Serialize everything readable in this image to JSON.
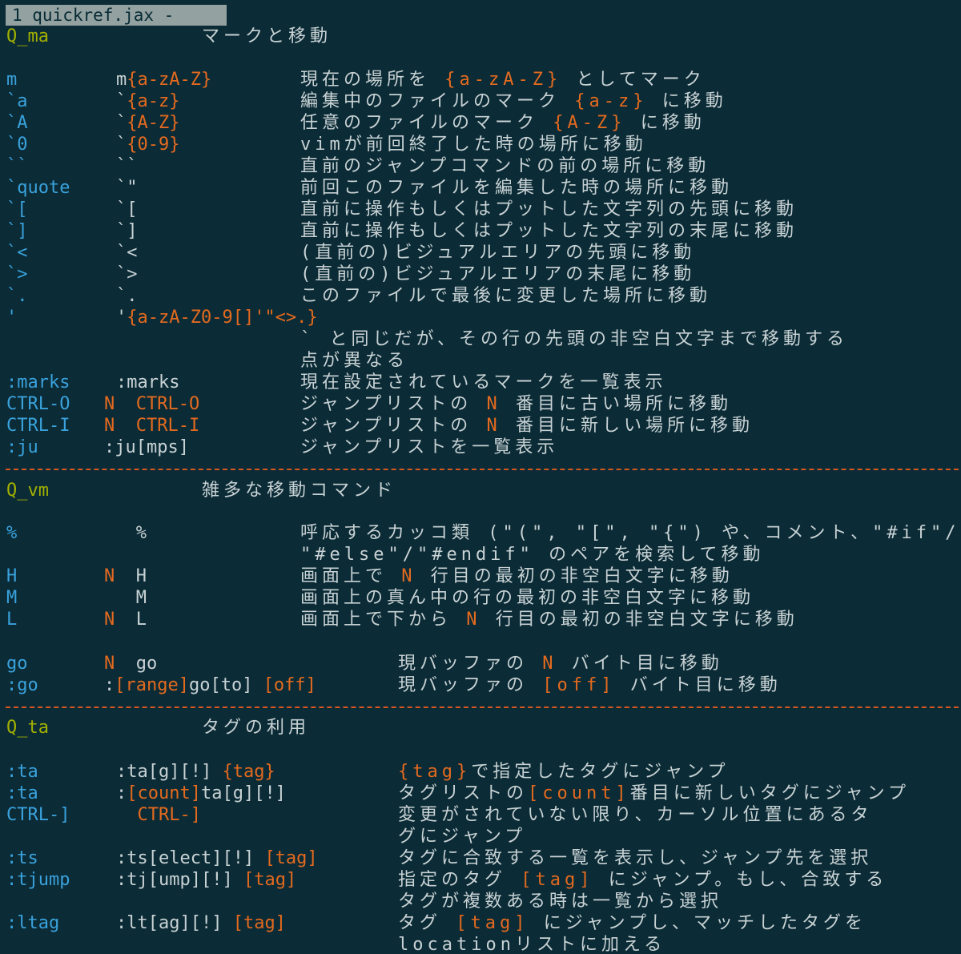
{
  "tab": {
    "label": "1 quickref.jax -"
  },
  "sections": [
    {
      "tag": "Q_ma",
      "title": "マークと移動",
      "entries": [
        {
          "key": "m",
          "cmd": [
            {
              "t": "m"
            },
            {
              "t": "{a-zA-Z}",
              "h": true
            }
          ],
          "desc": [
            {
              "t": "現在の場所を "
            },
            {
              "t": "{a-zA-Z}",
              "h": true
            },
            {
              "t": " としてマーク"
            }
          ]
        },
        {
          "key": "`a",
          "cmd": [
            {
              "t": "`"
            },
            {
              "t": "{a-z}",
              "h": true
            }
          ],
          "desc": [
            {
              "t": "編集中のファイルのマーク "
            },
            {
              "t": "{a-z}",
              "h": true
            },
            {
              "t": " に移動"
            }
          ]
        },
        {
          "key": "`A",
          "cmd": [
            {
              "t": "`"
            },
            {
              "t": "{A-Z}",
              "h": true
            }
          ],
          "desc": [
            {
              "t": "任意のファイルのマーク "
            },
            {
              "t": "{A-Z}",
              "h": true
            },
            {
              "t": " に移動"
            }
          ]
        },
        {
          "key": "`0",
          "cmd": [
            {
              "t": "`"
            },
            {
              "t": "{0-9}",
              "h": true
            }
          ],
          "desc": [
            {
              "t": "vimが前回終了した時の場所に移動"
            }
          ]
        },
        {
          "key": "``",
          "cmd": [
            {
              "t": "``"
            }
          ],
          "desc": [
            {
              "t": "直前のジャンプコマンドの前の場所に移動"
            }
          ]
        },
        {
          "key": "`quote",
          "cmd": [
            {
              "t": "`\""
            }
          ],
          "desc": [
            {
              "t": "前回このファイルを編集した時の場所に移動"
            }
          ]
        },
        {
          "key": "`[",
          "cmd": [
            {
              "t": "`["
            }
          ],
          "desc": [
            {
              "t": "直前に操作もしくはプットした文字列の先頭に移動"
            }
          ]
        },
        {
          "key": "`]",
          "cmd": [
            {
              "t": "`]"
            }
          ],
          "desc": [
            {
              "t": "直前に操作もしくはプットした文字列の末尾に移動"
            }
          ]
        },
        {
          "key": "`<",
          "cmd": [
            {
              "t": "`<"
            }
          ],
          "desc": [
            {
              "t": "(直前の)ビジュアルエリアの先頭に移動"
            }
          ]
        },
        {
          "key": "`>",
          "cmd": [
            {
              "t": "`>"
            }
          ],
          "desc": [
            {
              "t": "(直前の)ビジュアルエリアの末尾に移動"
            }
          ]
        },
        {
          "key": "`.",
          "cmd": [
            {
              "t": "`."
            }
          ],
          "desc": [
            {
              "t": "このファイルで最後に変更した場所に移動"
            }
          ]
        },
        {
          "key": "'",
          "cmd": [
            {
              "t": "'"
            },
            {
              "t": "{a-zA-Z0-9[]'\"<>.}",
              "h": true
            }
          ],
          "desc": []
        },
        {
          "key": "",
          "cmd": [],
          "desc": [
            {
              "t": "` と同じだが、その行の先頭の非空白文字まで移動する"
            }
          ]
        },
        {
          "key": "",
          "cmd": [],
          "desc": [
            {
              "t": "点が異なる"
            }
          ]
        },
        {
          "key": ":marks",
          "cmd": [
            {
              "t": ":marks"
            }
          ],
          "desc": [
            {
              "t": "現在設定されているマークを一覧表示"
            }
          ]
        },
        {
          "key": "CTRL-O",
          "cmd": [
            {
              "t": "N",
              "h": true
            },
            {
              "t": "  CTRL-O",
              "h": true
            }
          ],
          "desc": [
            {
              "t": "ジャンプリストの "
            },
            {
              "t": "N",
              "h": true
            },
            {
              "t": " 番目に古い場所に移動"
            }
          ]
        },
        {
          "key": "CTRL-I",
          "cmd": [
            {
              "t": "N",
              "h": true
            },
            {
              "t": "  CTRL-I",
              "h": true
            }
          ],
          "desc": [
            {
              "t": "ジャンプリストの "
            },
            {
              "t": "N",
              "h": true
            },
            {
              "t": " 番目に新しい場所に移動"
            }
          ]
        },
        {
          "key": ":ju",
          "cmd": [
            {
              "t": ":ju[mps]"
            }
          ],
          "desc": [
            {
              "t": "ジャンプリストを一覧表示"
            }
          ]
        }
      ]
    },
    {
      "tag": "Q_vm",
      "title": "雑多な移動コマンド",
      "entries": [
        {
          "key": "%",
          "cmd": [
            {
              "t": "   %"
            }
          ],
          "desc": [
            {
              "t": "呼応するカッコ類 (\"(\", \"[\", \"{\") や、コメント、\"#if\"/"
            }
          ]
        },
        {
          "key": "",
          "cmd": [],
          "desc": [
            {
              "t": "\"#else\"/\"#endif\" のペアを検索して移動"
            }
          ]
        },
        {
          "key": "H",
          "cmd": [
            {
              "t": "N",
              "h": true
            },
            {
              "t": "  H"
            }
          ],
          "desc": [
            {
              "t": "画面上で "
            },
            {
              "t": "N",
              "h": true
            },
            {
              "t": " 行目の最初の非空白文字に移動"
            }
          ]
        },
        {
          "key": "M",
          "cmd": [
            {
              "t": "   M"
            }
          ],
          "desc": [
            {
              "t": "画面上の真ん中の行の最初の非空白文字に移動"
            }
          ]
        },
        {
          "key": "L",
          "cmd": [
            {
              "t": "N",
              "h": true
            },
            {
              "t": "  L"
            }
          ],
          "desc": [
            {
              "t": "画面上で下から "
            },
            {
              "t": "N",
              "h": true
            },
            {
              "t": " 行目の最初の非空白文字に移動"
            }
          ]
        },
        {
          "key": "go",
          "cmd": [
            {
              "t": "N",
              "h": true
            },
            {
              "t": "  go"
            }
          ],
          "desc": [
            {
              "t": "現バッファの "
            },
            {
              "t": "N",
              "h": true
            },
            {
              "t": " バイト目に移動"
            }
          ]
        },
        {
          "key": ":go",
          "cmd": [
            {
              "t": ":"
            },
            {
              "t": "[range]",
              "h": true
            },
            {
              "t": "go[to] "
            },
            {
              "t": "[off]",
              "h": true
            }
          ],
          "desc": [
            {
              "t": "現バッファの "
            },
            {
              "t": "[off]",
              "h": true
            },
            {
              "t": " バイト目に移動"
            }
          ]
        }
      ]
    },
    {
      "tag": "Q_ta",
      "title": "タグの利用",
      "entries": [
        {
          "key": ":ta",
          "cmd": [
            {
              "t": ":ta[g][!] "
            },
            {
              "t": "{tag}",
              "h": true
            }
          ],
          "desc": [
            {
              "t": "{tag}",
              "h": true
            },
            {
              "t": "で指定したタグにジャンプ"
            }
          ]
        },
        {
          "key": ":ta",
          "cmd": [
            {
              "t": ":"
            },
            {
              "t": "[count]",
              "h": true
            },
            {
              "t": "ta[g][!]"
            }
          ],
          "desc": [
            {
              "t": "タグリストの"
            },
            {
              "t": "[count]",
              "h": true
            },
            {
              "t": "番目に新しいタグにジャンプ"
            }
          ]
        },
        {
          "key": "CTRL-]",
          "cmd": [
            {
              "t": "  CTRL-]",
              "h": true
            }
          ],
          "desc": [
            {
              "t": "変更がされていない限り、カーソル位置にあるタ"
            }
          ]
        },
        {
          "key": "",
          "cmd": [],
          "desc": [
            {
              "t": "グにジャンプ"
            }
          ]
        },
        {
          "key": ":ts",
          "cmd": [
            {
              "t": ":ts[elect][!] "
            },
            {
              "t": "[tag]",
              "h": true
            }
          ],
          "desc": [
            {
              "t": "タグに合致する一覧を表示し、ジャンプ先を選択"
            }
          ]
        },
        {
          "key": ":tjump",
          "cmd": [
            {
              "t": ":tj[ump][!] "
            },
            {
              "t": "[tag]",
              "h": true
            }
          ],
          "desc": [
            {
              "t": "指定のタグ "
            },
            {
              "t": "[tag]",
              "h": true
            },
            {
              "t": " にジャンプ。もし、合致する"
            }
          ]
        },
        {
          "key": "",
          "cmd": [],
          "desc": [
            {
              "t": "タグが複数ある時は一覧から選択"
            }
          ]
        },
        {
          "key": ":ltag",
          "cmd": [
            {
              "t": ":lt[ag][!] "
            },
            {
              "t": "[tag]",
              "h": true
            }
          ],
          "desc": [
            {
              "t": "タグ "
            },
            {
              "t": "[tag]",
              "h": true
            },
            {
              "t": " にジャンプし、マッチしたタグを"
            }
          ]
        },
        {
          "key": "",
          "cmd": [],
          "desc": [
            {
              "t": "locationリストに加える"
            }
          ]
        }
      ]
    }
  ],
  "colors": {
    "background": "#0b2b36",
    "heading": "#a2b000",
    "keyword": "#3aa2dc",
    "highlight": "#e36a1f",
    "text": "#c8d2d4",
    "separator": "#d5571d"
  }
}
